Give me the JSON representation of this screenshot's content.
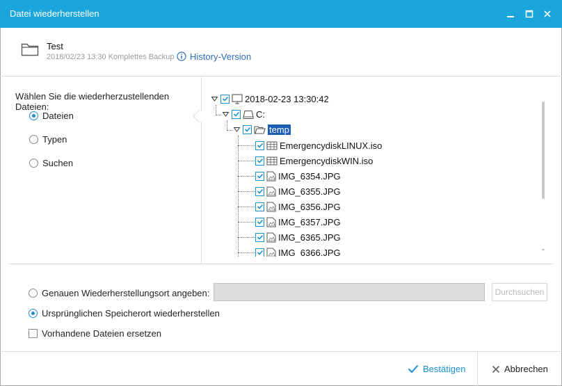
{
  "window": {
    "title": "Datei wiederherstellen",
    "controls": [
      "minimize-icon",
      "maximize-icon",
      "close-icon"
    ]
  },
  "backup": {
    "icon": "folder-icon",
    "name": "Test",
    "meta": "2018/02/23 13:30 Komplettes Backup",
    "history_link": "History-Version"
  },
  "selection": {
    "prompt": "Wählen Sie die wiederherzustellenden Dateien:",
    "modes": [
      {
        "label": "Dateien",
        "selected": true
      },
      {
        "label": "Typen",
        "selected": false
      },
      {
        "label": "Suchen",
        "selected": false
      }
    ]
  },
  "tree": {
    "root": "2018-02-23 13:30:42",
    "drive": "C:",
    "folder": "temp",
    "files": [
      {
        "name": "EmergencydiskLINUX.iso",
        "icon": "iso-file-icon"
      },
      {
        "name": "EmergencydiskWIN.iso",
        "icon": "iso-file-icon"
      },
      {
        "name": "IMG_6354.JPG",
        "icon": "image-file-icon"
      },
      {
        "name": "IMG_6355.JPG",
        "icon": "image-file-icon"
      },
      {
        "name": "IMG_6356.JPG",
        "icon": "image-file-icon"
      },
      {
        "name": "IMG_6357.JPG",
        "icon": "image-file-icon"
      },
      {
        "name": "IMG_6365.JPG",
        "icon": "image-file-icon"
      },
      {
        "name": "IMG_6366.JPG",
        "icon": "image-file-icon"
      }
    ]
  },
  "restore": {
    "custom_location_label": "Genauen Wiederherstellungsort angeben:",
    "custom_location_value": "",
    "browse_label": "Durchsuchen",
    "original_location_label": "Ursprünglichen Speicherort wiederherstellen",
    "replace_label": "Vorhandene Dateien ersetzen",
    "selected_option": "original"
  },
  "footer": {
    "confirm_label": "Bestätigen",
    "cancel_label": "Abbrechen"
  },
  "colors": {
    "titlebar": "#1aa5dc",
    "accent": "#1a8fd0",
    "link": "#2a6fb5",
    "selection": "#1a5fb4"
  }
}
